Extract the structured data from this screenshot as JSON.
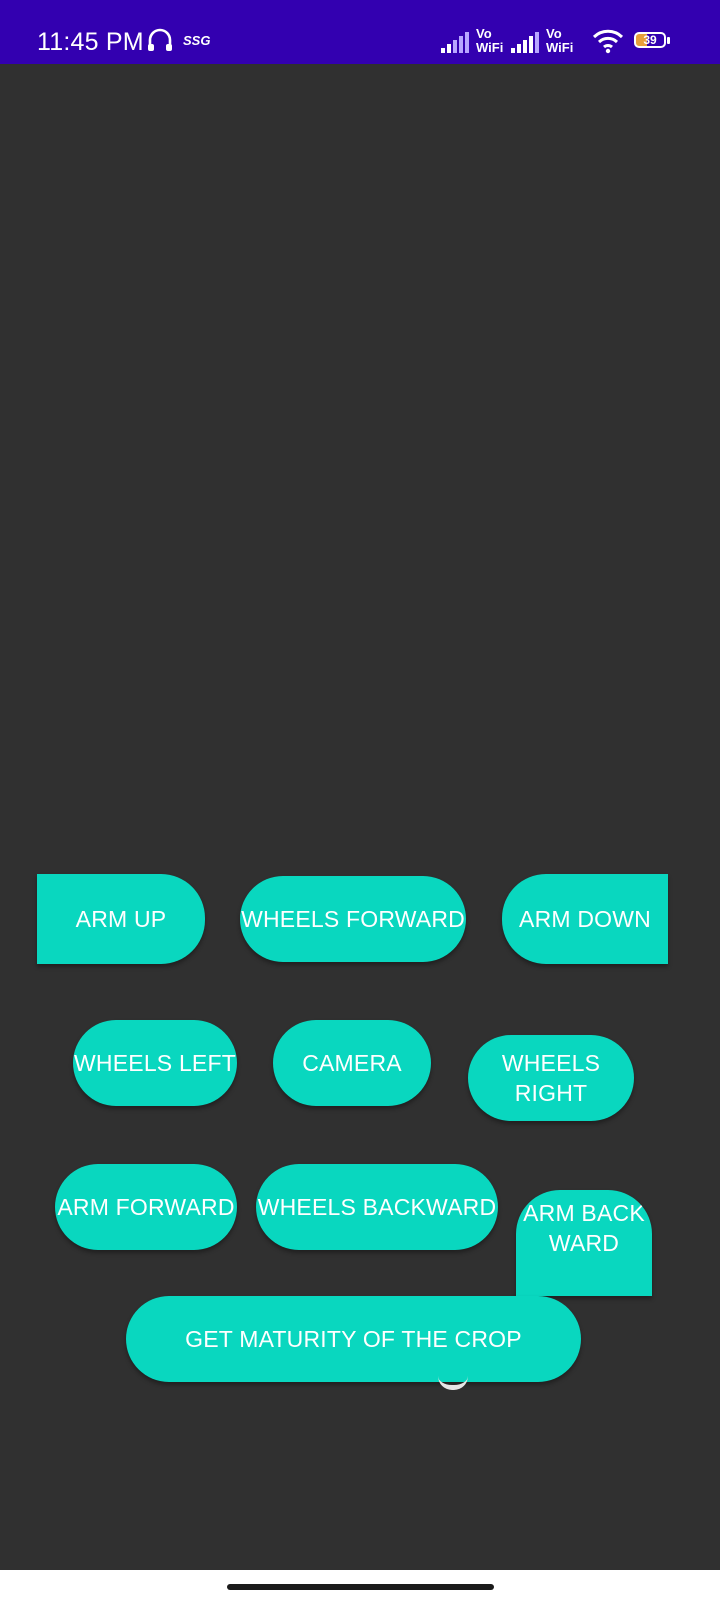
{
  "status_bar": {
    "time": "11:45 PM",
    "network_label": "SSG",
    "vowifi_1": "Vo\nWiFi",
    "vowifi_2": "Vo\nWiFi",
    "battery": "39",
    "icons": [
      "headset-icon",
      "signal-icon",
      "wifi-icon",
      "battery-icon"
    ],
    "color": "#3300b0"
  },
  "controls": {
    "arm_up": "ARM UP",
    "wheels_forward": "WHEELS FORWARD",
    "arm_down": "ARM DOWN",
    "wheels_left": "WHEELS LEFT",
    "camera": "CAMERA",
    "wheels_right": "WHEELS RIGHT",
    "arm_forward": "ARM FORWARD",
    "wheels_backward": "WHEELS BACKWARD",
    "arm_backward": "ARM BACKWARD",
    "get_maturity": "GET MATURITY OF THE CROP"
  },
  "colors": {
    "background": "#303030",
    "button": "#09d7bf",
    "button_text": "#ffffff"
  }
}
